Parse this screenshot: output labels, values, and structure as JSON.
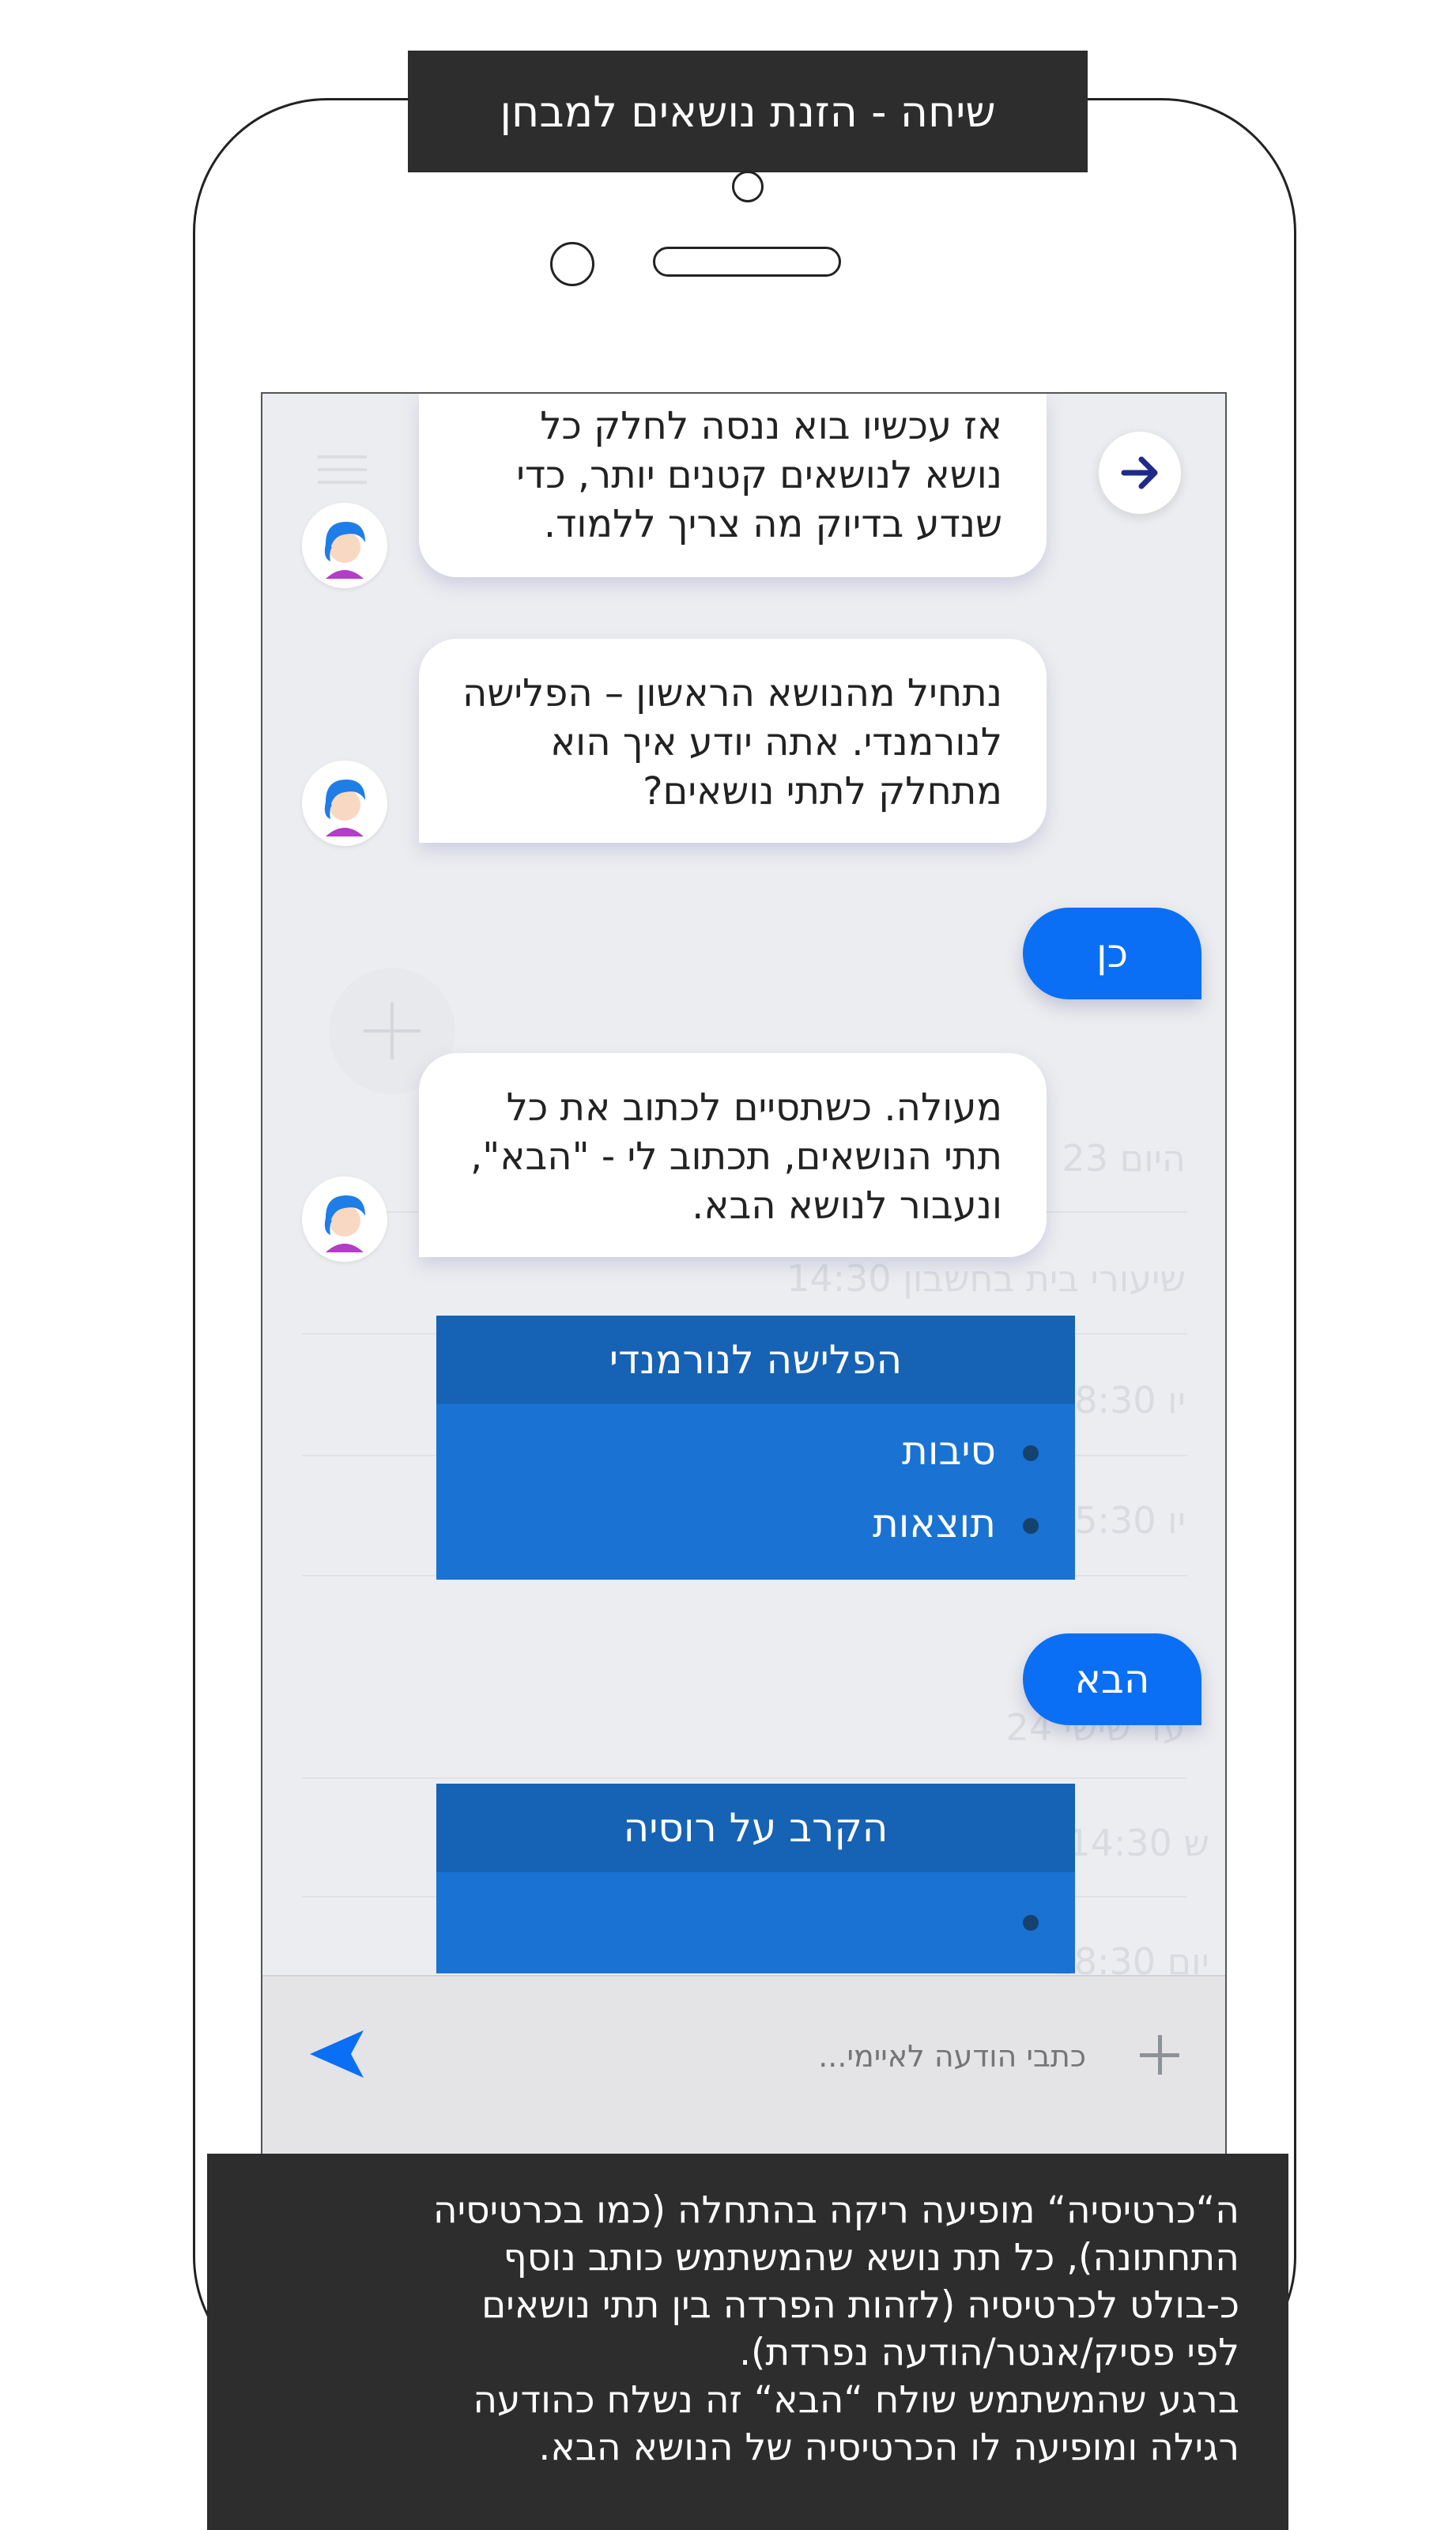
{
  "header": {
    "title": "שיחה - הזנת נושאים למבחן"
  },
  "background_ghost": {
    "day_label": "היום 23",
    "times": [
      "14:30 שיעורי בית בחשבון",
      "18:30 יו",
      "15:30 יו"
    ],
    "second_day_label": "עד שישי 24",
    "times2": [
      "14:30 ש",
      "18:30 יום"
    ]
  },
  "chat": {
    "messages": [
      {
        "from": "bot",
        "text": "אז עכשיו בוא ננסה לחלק כל נושא לנושאים קטנים יותר, כדי שנדע בדיוק מה צריך ללמוד."
      },
      {
        "from": "bot",
        "text": "נתחיל מהנושא הראשון – הפלישה לנורמנדי. אתה יודע איך הוא מתחלק לתתי נושאים?"
      },
      {
        "from": "user",
        "text": "כן"
      },
      {
        "from": "bot",
        "text": "מעולה. כשתסיים לכתוב את כל תתי הנושאים, תכתוב לי - \"הבא\", ונעבור לנושא הבא."
      },
      {
        "from": "user",
        "text": "הבא"
      }
    ],
    "cards": [
      {
        "title": "הפלישה לנורמנדי",
        "items": [
          "סיבות",
          "תוצאות"
        ]
      },
      {
        "title": "הקרב על רוסיה",
        "items": [
          ""
        ]
      }
    ]
  },
  "input": {
    "placeholder": "כתבי הודעה לאיימי..."
  },
  "icons": {
    "back": "arrow-right-icon",
    "send": "send-icon",
    "add": "plus-icon",
    "menu": "menu-icon"
  },
  "colors": {
    "accent": "#0a6ff5",
    "card": "#1a72d2",
    "card_header": "#1662b4",
    "dark_box": "#2d2d2d"
  },
  "note": {
    "lines": [
      "ה“כרטיסיה“ מופיעה ריקה בהתחלה (כמו בכרטיסיה",
      "התחתונה), כל תת נושא שהמשתמש כותב נוסף",
      "כ-בולט לכרטיסיה (לזהות הפרדה בין תתי נושאים",
      "לפי פסיק/אנטר/הודעה נפרדת).",
      "ברגע שהמשתמש שולח “הבא“ זה נשלח כהודעה",
      "רגילה ומופיעה לו הכרטיסיה של הנושא הבא."
    ]
  }
}
